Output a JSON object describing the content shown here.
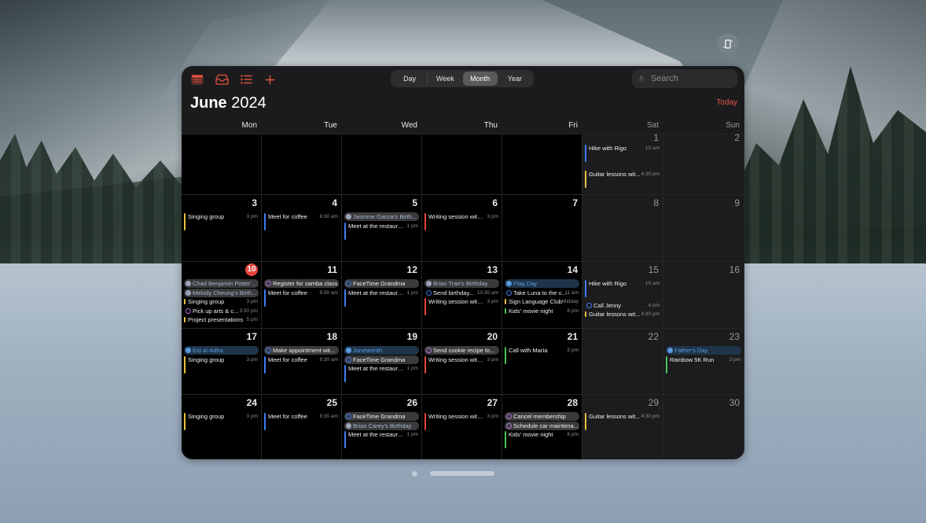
{
  "app": {
    "title_month": "June",
    "title_year": "2024",
    "today_label": "Today"
  },
  "toolbar": {
    "icons": [
      "calendar-icon",
      "inbox-icon",
      "list-icon",
      "add-icon"
    ],
    "views": [
      {
        "label": "Day",
        "active": false
      },
      {
        "label": "Week",
        "active": false
      },
      {
        "label": "Month",
        "active": true
      },
      {
        "label": "Year",
        "active": false
      }
    ],
    "search_placeholder": "Search",
    "accent_color": "#e5533f"
  },
  "weekdays": [
    "Mon",
    "Tue",
    "Wed",
    "Thu",
    "Fri",
    "Sat",
    "Sun"
  ],
  "colors": {
    "blue": "#3d7ef0",
    "yellow": "#e8c13d",
    "red": "#e5453b",
    "green": "#4cc255",
    "purple": "#b071d6",
    "holiday": "#5a9be0"
  },
  "today_day": 10,
  "weeks": [
    [
      {
        "day": null
      },
      {
        "day": null
      },
      {
        "day": null
      },
      {
        "day": null
      },
      {
        "day": null
      },
      {
        "day": 1,
        "events": [
          {
            "kind": "timed",
            "name": "Hike with Rigo",
            "time": "10 am",
            "color": "blue"
          },
          {
            "kind": "timed",
            "name": "Guitar lessons wit...",
            "time": "4:30 pm",
            "color": "yellow"
          }
        ]
      },
      {
        "day": 2,
        "events": []
      }
    ],
    [
      {
        "day": 3,
        "events": [
          {
            "kind": "timed",
            "name": "Singing group",
            "time": "3 pm",
            "color": "yellow"
          }
        ]
      },
      {
        "day": 4,
        "events": [
          {
            "kind": "timed",
            "name": "Meet for coffee",
            "time": "8:30 am",
            "color": "blue"
          }
        ]
      },
      {
        "day": 5,
        "events": [
          {
            "kind": "bday",
            "name": "Jasmine Garcia's Birth..."
          },
          {
            "kind": "timed",
            "name": "Meet at the restaurant",
            "time": "1 pm",
            "color": "blue"
          }
        ]
      },
      {
        "day": 6,
        "events": [
          {
            "kind": "timed",
            "name": "Writing session with...",
            "time": "3 pm",
            "color": "red"
          }
        ]
      },
      {
        "day": 7,
        "events": []
      },
      {
        "day": 8,
        "events": []
      },
      {
        "day": 9,
        "events": []
      }
    ],
    [
      {
        "day": 10,
        "events": [
          {
            "kind": "bday",
            "name": "Chad Benjamin Potter'..."
          },
          {
            "kind": "bday",
            "name": "Melody Cheung's Birth..."
          },
          {
            "kind": "short",
            "name": "Singing group",
            "time": "3 pm",
            "color": "yellow"
          },
          {
            "kind": "task",
            "name": "Pick up arts & c...",
            "time": "3:30 pm",
            "color": "purple"
          },
          {
            "kind": "short",
            "name": "Project presentations",
            "time": "5 pm",
            "color": "yellow"
          }
        ]
      },
      {
        "day": 11,
        "events": [
          {
            "kind": "taskpill",
            "name": "Register for samba class",
            "color": "purple"
          },
          {
            "kind": "timed",
            "name": "Meet for coffee",
            "time": "8:30 am",
            "color": "blue"
          }
        ]
      },
      {
        "day": 12,
        "events": [
          {
            "kind": "taskpill",
            "name": "FaceTime Grandma",
            "color": "blue"
          },
          {
            "kind": "timed",
            "name": "Meet at the restaurant",
            "time": "1 pm",
            "color": "blue"
          }
        ]
      },
      {
        "day": 13,
        "events": [
          {
            "kind": "bday",
            "name": "Brian Tran's Birthday"
          },
          {
            "kind": "task",
            "name": "Send birthday...",
            "time": "10:30 am",
            "color": "blue"
          },
          {
            "kind": "timed",
            "name": "Writing session with...",
            "time": "3 pm",
            "color": "red"
          }
        ]
      },
      {
        "day": 14,
        "events": [
          {
            "kind": "holiday",
            "name": "Flag Day"
          },
          {
            "kind": "task",
            "name": "Take Luna to the v...",
            "time": "11 am",
            "color": "blue"
          },
          {
            "kind": "short",
            "name": "Sign Language Club",
            "time": "Midday",
            "color": "yellow"
          },
          {
            "kind": "short",
            "name": "Kids' movie night",
            "time": "6 pm",
            "color": "green"
          }
        ]
      },
      {
        "day": 15,
        "events": [
          {
            "kind": "timed",
            "name": "Hike with Rigo",
            "time": "10 am",
            "color": "blue"
          },
          {
            "kind": "task",
            "name": "Call Jenny",
            "time": "4 pm",
            "color": "blue"
          },
          {
            "kind": "short",
            "name": "Guitar lessons wit...",
            "time": "4:30 pm",
            "color": "yellow"
          }
        ]
      },
      {
        "day": 16,
        "events": []
      }
    ],
    [
      {
        "day": 17,
        "events": [
          {
            "kind": "holiday",
            "name": "Eid al-Adha"
          },
          {
            "kind": "timed",
            "name": "Singing group",
            "time": "3 pm",
            "color": "yellow"
          }
        ]
      },
      {
        "day": 18,
        "events": [
          {
            "kind": "taskpill",
            "name": "Make appointment wit...",
            "color": "blue"
          },
          {
            "kind": "timed",
            "name": "Meet for coffee",
            "time": "8:30 am",
            "color": "blue"
          }
        ]
      },
      {
        "day": 19,
        "events": [
          {
            "kind": "holiday",
            "name": "Juneteenth"
          },
          {
            "kind": "taskpill",
            "name": "FaceTime Grandma",
            "color": "blue"
          },
          {
            "kind": "timed",
            "name": "Meet at the restaurant",
            "time": "1 pm",
            "color": "blue"
          }
        ]
      },
      {
        "day": 20,
        "events": [
          {
            "kind": "taskpill",
            "name": "Send cookie recipe to...",
            "color": "purple"
          },
          {
            "kind": "timed",
            "name": "Writing session with...",
            "time": "3 pm",
            "color": "red"
          }
        ]
      },
      {
        "day": 21,
        "events": [
          {
            "kind": "timed",
            "name": "Call with María",
            "time": "5 pm",
            "color": "green"
          }
        ]
      },
      {
        "day": 22,
        "events": []
      },
      {
        "day": 23,
        "events": [
          {
            "kind": "holiday",
            "name": "Father's Day"
          },
          {
            "kind": "timed",
            "name": "Rainbow 5K Run",
            "time": "3 pm",
            "color": "green"
          }
        ]
      }
    ],
    [
      {
        "day": 24,
        "events": [
          {
            "kind": "timed",
            "name": "Singing group",
            "time": "3 pm",
            "color": "yellow"
          }
        ]
      },
      {
        "day": 25,
        "events": [
          {
            "kind": "timed",
            "name": "Meet for coffee",
            "time": "8:30 am",
            "color": "blue"
          }
        ]
      },
      {
        "day": 26,
        "events": [
          {
            "kind": "taskpill",
            "name": "FaceTime Grandma",
            "color": "blue"
          },
          {
            "kind": "bday",
            "name": "Brian Carey's Birthday"
          },
          {
            "kind": "timed",
            "name": "Meet at the restaurant",
            "time": "1 pm",
            "color": "blue"
          }
        ]
      },
      {
        "day": 27,
        "events": [
          {
            "kind": "timed",
            "name": "Writing session with...",
            "time": "3 pm",
            "color": "red"
          }
        ]
      },
      {
        "day": 28,
        "events": [
          {
            "kind": "taskpill",
            "name": "Cancel membership",
            "color": "purple"
          },
          {
            "kind": "taskpill",
            "name": "Schedule car maintena...",
            "color": "purple"
          },
          {
            "kind": "timed",
            "name": "Kids' movie night",
            "time": "6 pm",
            "color": "green"
          }
        ]
      },
      {
        "day": 29,
        "events": [
          {
            "kind": "timed",
            "name": "Guitar lessons wit...",
            "time": "4:30 pm",
            "color": "yellow"
          }
        ]
      },
      {
        "day": 30,
        "events": []
      }
    ]
  ],
  "window_controls": {
    "icons": [
      "window-dot",
      "window-grabber"
    ],
    "float_icon": "rotate-device-icon"
  }
}
